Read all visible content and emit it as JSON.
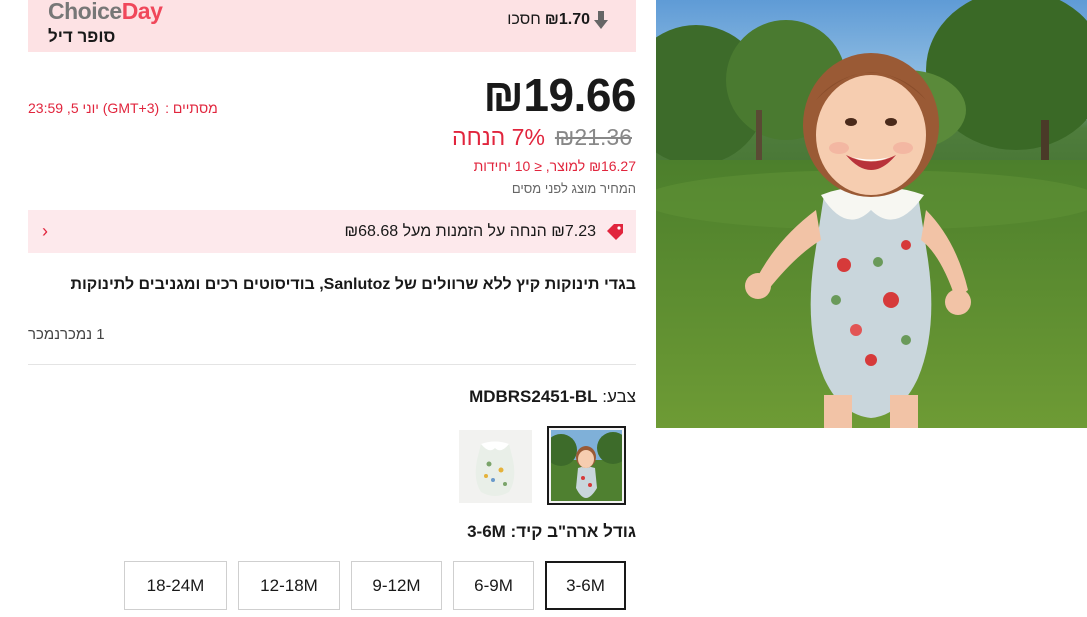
{
  "choice": {
    "logo_part1": "Choice",
    "logo_part2": "Day",
    "subtitle": "סופר דיל",
    "save_amount": "₪1.70",
    "save_label": "חסכו"
  },
  "price": {
    "current": "₪19.66",
    "original": "₪21.36",
    "discount": "7% הנחה",
    "unit_price": "₪16.27 למוצר, ≤ 10 יחידות",
    "tax_note": "המחיר מוצג לפני מסים"
  },
  "promo_end": {
    "label": "מסתיים :",
    "date": "יוני 5, 23:59 (GMT+3)"
  },
  "coupon": {
    "text": "₪7.23 הנחה על הזמנות מעל ₪68.68"
  },
  "product": {
    "title": "בגדי תינוקות קיץ ללא שרוולים של Sanlutoz, בודיסוטים רכים ומגניבים לתינוקות",
    "sold": "1 נמכרנמכר"
  },
  "color": {
    "label": "צבע:",
    "value": "MDBRS2451-BL"
  },
  "size": {
    "label": "גודל ארה\"ב קיד:",
    "value": "3-6M",
    "options": [
      "3-6M",
      "6-9M",
      "9-12M",
      "12-18M",
      "18-24M"
    ]
  },
  "colors": {
    "accent": "#e1253d",
    "banner_bg": "#fde2e4",
    "coupon_bg": "#fde9ec"
  }
}
